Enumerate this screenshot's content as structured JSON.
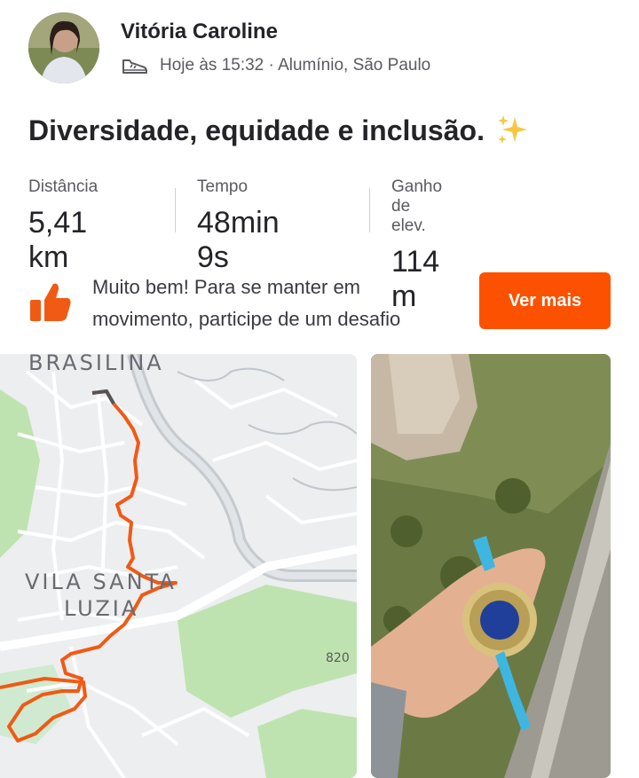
{
  "activity": {
    "user_name": "Vitória Caroline",
    "meta": "Hoje às 15:32 · Alumínio, São Paulo",
    "title": "Diversidade, equidade e inclusão.",
    "stats": [
      {
        "label": "Distância",
        "value": "5,41 km"
      },
      {
        "label": "Tempo",
        "value": "48min 9s"
      },
      {
        "label": "Ganho de elev.",
        "value": "114 m"
      }
    ]
  },
  "promo": {
    "line1": "Muito bem! Para se manter em",
    "line2": "movimento, participe de um desafio",
    "button": "Ver mais"
  },
  "map": {
    "labels": {
      "brasilina": "BRASILINA",
      "vila1": "VILA SANTA",
      "vila2": "LUZIA",
      "road_num": "820"
    }
  },
  "colors": {
    "accent": "#fc5200",
    "route": "#f05a14",
    "park": "#b8e3a8",
    "road": "#c9ced3"
  }
}
